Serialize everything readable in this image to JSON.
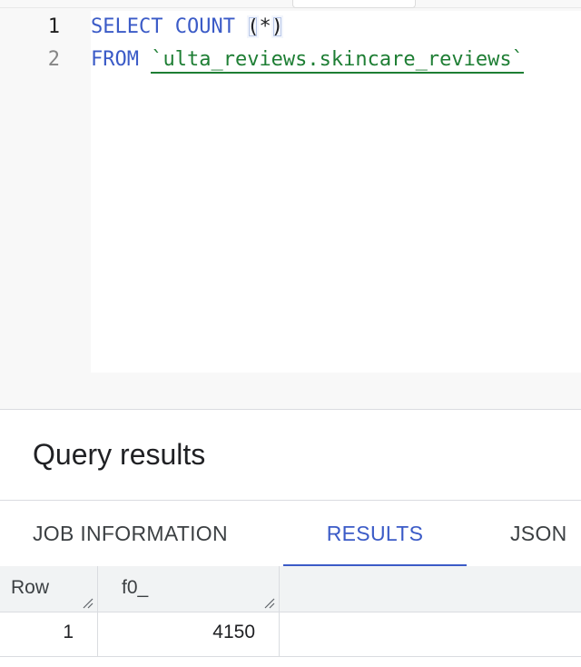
{
  "editor": {
    "lines": [
      {
        "number": "1",
        "keyword": "SELECT",
        "function": "COUNT",
        "open_paren": "(",
        "star": "*",
        "close_paren": ")"
      },
      {
        "number": "2",
        "keyword": "FROM",
        "table": "`ulta_reviews.skincare_reviews`"
      }
    ]
  },
  "results": {
    "title": "Query results",
    "tabs": [
      {
        "label": "JOB INFORMATION"
      },
      {
        "label": "RESULTS"
      },
      {
        "label": "JSON"
      }
    ],
    "active_tab": "RESULTS",
    "columns": [
      "Row",
      "f0_"
    ],
    "rows": [
      [
        "1",
        "4150"
      ]
    ]
  },
  "colors": {
    "keyword": "#3b5bc7",
    "table": "#1e7e34",
    "active_tab": "#3b5bc7"
  }
}
